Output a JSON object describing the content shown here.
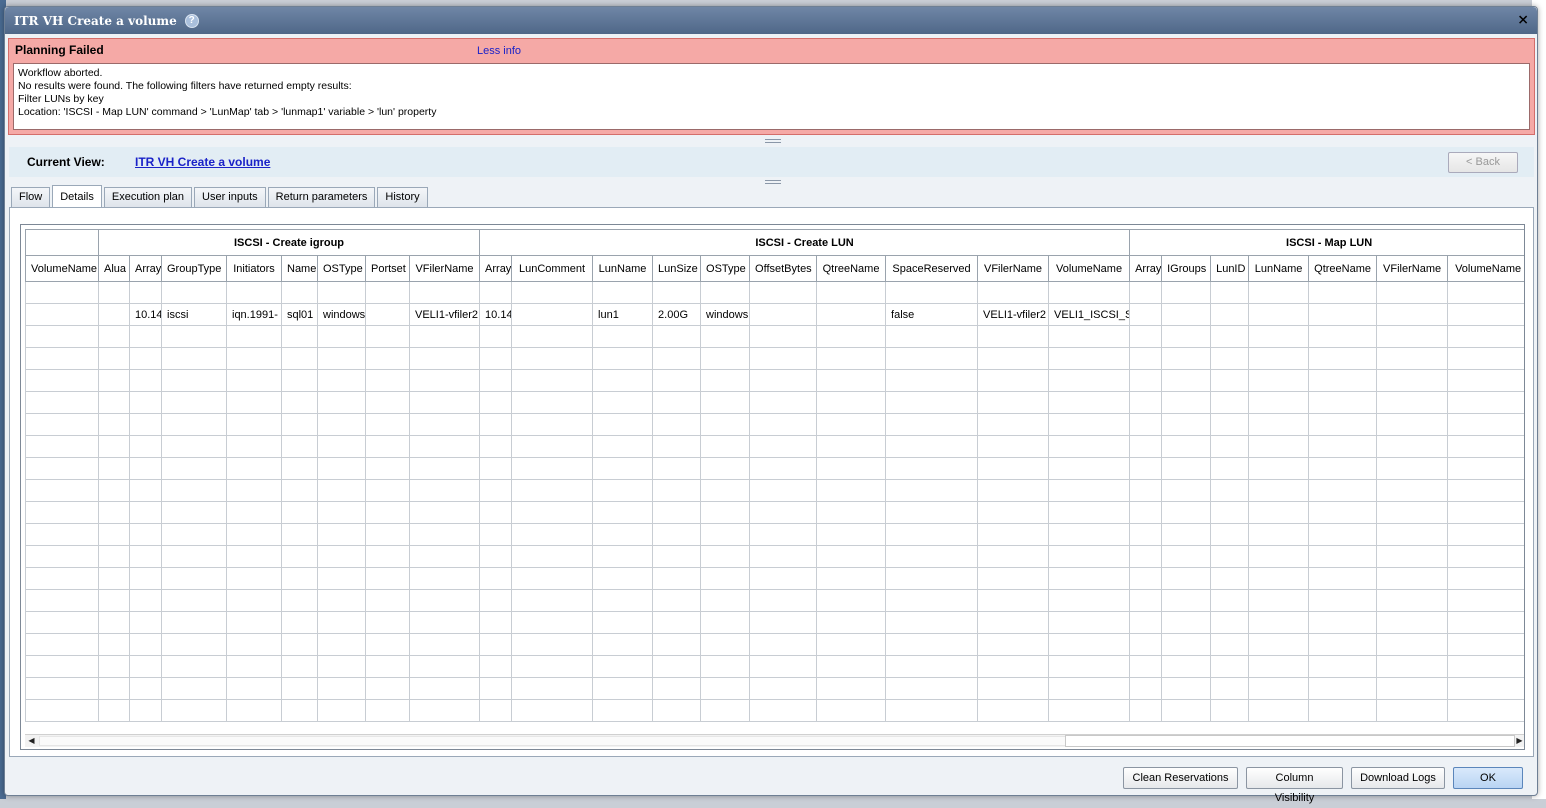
{
  "dialog": {
    "title": "ITR VH Create a volume",
    "help_glyph": "?",
    "close_glyph": "×"
  },
  "error": {
    "title": "Planning Failed",
    "toggle_label": "Less info",
    "lines": [
      "Workflow aborted.",
      "No results were found. The following filters have returned empty results:",
      "Filter LUNs by key",
      "Location: 'ISCSI - Map LUN' command > 'LunMap' tab > 'lunmap1' variable > 'lun' property"
    ]
  },
  "current_view": {
    "label": "Current View:",
    "link": "ITR VH Create a volume",
    "back_label": "< Back"
  },
  "tabs": [
    {
      "label": "Flow"
    },
    {
      "label": "Details"
    },
    {
      "label": "Execution plan"
    },
    {
      "label": "User inputs"
    },
    {
      "label": "Return parameters"
    },
    {
      "label": "History"
    }
  ],
  "grid": {
    "groups": [
      "ISCSI - Create igroup",
      "ISCSI - Create LUN",
      "ISCSI - Map LUN"
    ],
    "first_column": "VolumeName",
    "igroup_columns": [
      "Alua",
      "Array",
      "GroupType",
      "Initiators",
      "Name",
      "OSType",
      "Portset",
      "VFilerName"
    ],
    "lun_columns": [
      "Array",
      "LunComment",
      "LunName",
      "LunSize",
      "OSType",
      "OffsetBytes",
      "QtreeName",
      "SpaceReserved",
      "VFilerName",
      "VolumeName"
    ],
    "map_columns": [
      "Array",
      "IGroups",
      "LunID",
      "LunName",
      "QtreeName",
      "VFilerName",
      "VolumeName"
    ],
    "data_row": {
      "volume": "",
      "igroup": [
        "",
        "10.14",
        "iscsi",
        "iqn.1991-",
        "sql01",
        "windows",
        "",
        "VELI1-vfiler2"
      ],
      "lun": [
        "10.14",
        "",
        "lun1",
        "2.00G",
        "windows",
        "",
        "",
        "false",
        "VELI1-vfiler2",
        "VELI1_ISCSI_S"
      ],
      "map": [
        "",
        "",
        "",
        "",
        "",
        "",
        ""
      ]
    }
  },
  "footer": {
    "clean_label": "Clean Reservations",
    "columns_label": "Column Visibility",
    "logs_label": "Download Logs",
    "ok_label": "OK"
  }
}
